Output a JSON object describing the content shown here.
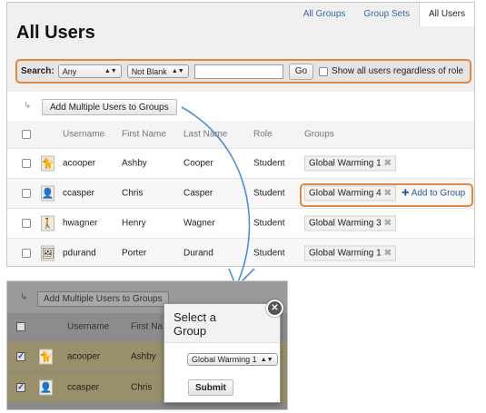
{
  "tabs": [
    "All Groups",
    "Group Sets",
    "All Users"
  ],
  "page_title": "All Users",
  "search": {
    "label": "Search:",
    "field_value": "Any",
    "operator_value": "Not Blank",
    "input_value": "",
    "go_label": "Go",
    "show_all_label": "Show all users regardless of role"
  },
  "action_button": "Add Multiple Users to Groups",
  "columns": {
    "username": "Username",
    "first_name": "First Name",
    "last_name": "Last Name",
    "role": "Role",
    "groups": "Groups"
  },
  "rows": [
    {
      "username": "acooper",
      "first": "Ashby",
      "last": "Cooper",
      "role": "Student",
      "group": "Global Warming 1",
      "avatar_icon": "cat-avatar-icon"
    },
    {
      "username": "ccasper",
      "first": "Chris",
      "last": "Casper",
      "role": "Student",
      "group": "Global Warming 4",
      "avatar_icon": "person-avatar-icon",
      "add_label": "Add to Group"
    },
    {
      "username": "hwagner",
      "first": "Henry",
      "last": "Wagner",
      "role": "Student",
      "group": "Global Warming 3",
      "avatar_icon": "figure-avatar-icon"
    },
    {
      "username": "pdurand",
      "first": "Porter",
      "last": "Durand",
      "role": "Student",
      "group": "Global Warming 1",
      "avatar_icon": "portrait-avatar-icon"
    }
  ],
  "bottom": {
    "action_button": "Add Multiple Users to Groups",
    "col_username": "Username",
    "col_first": "First Na",
    "rows": [
      {
        "username": "acooper",
        "first": "Ashby"
      },
      {
        "username": "ccasper",
        "first": "Chris"
      }
    ]
  },
  "modal": {
    "title": "Select a Group",
    "select_value": "Global Warming 1",
    "submit_label": "Submit"
  },
  "colors": {
    "highlight": "#e0893a",
    "link": "#3a66a8",
    "connector": "#4a90d9"
  }
}
